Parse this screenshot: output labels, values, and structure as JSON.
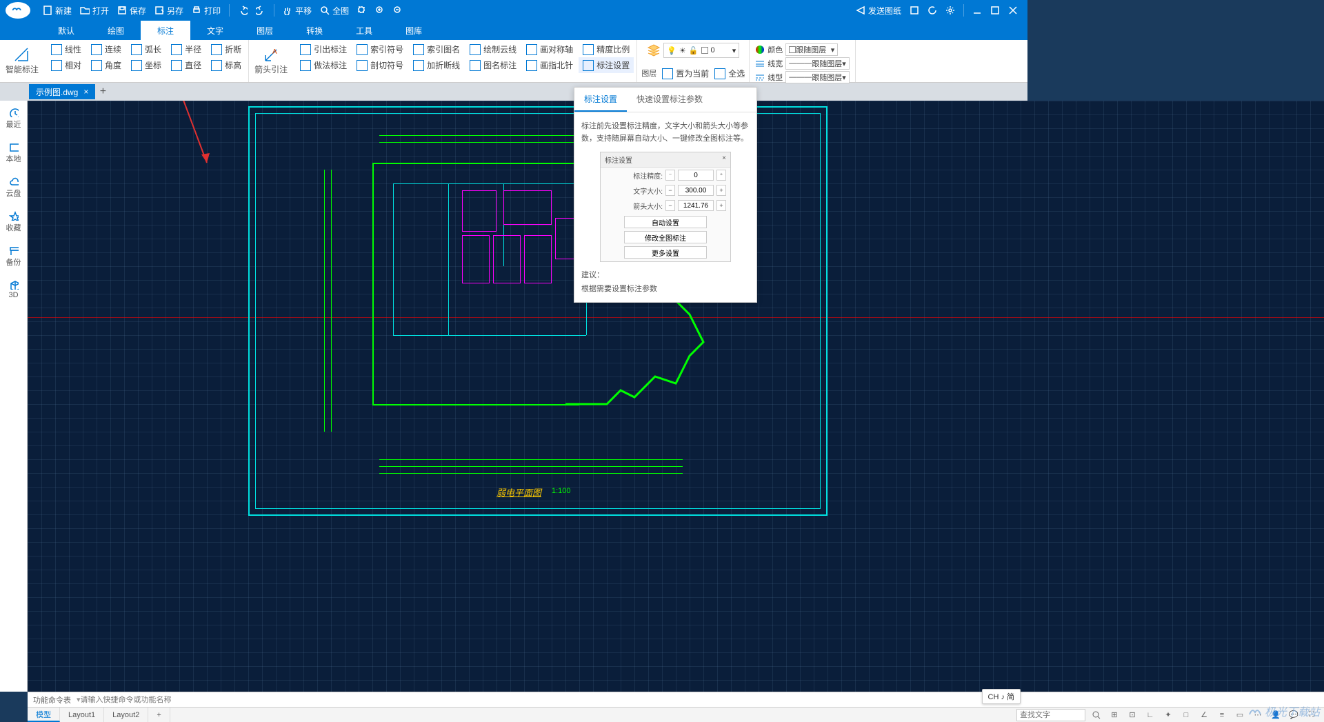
{
  "titlebar": {
    "new": "新建",
    "open": "打开",
    "save": "保存",
    "saveas": "另存",
    "print": "打印",
    "pan": "平移",
    "fullview": "全图",
    "send": "发送图纸"
  },
  "menutabs": {
    "items": [
      "默认",
      "绘图",
      "标注",
      "文字",
      "图层",
      "转换",
      "工具",
      "图库"
    ],
    "active_index": 2
  },
  "ribbon": {
    "smart_dim": "智能标注",
    "r1": {
      "linear": "线性",
      "continuous": "连续",
      "arc": "弧长",
      "radius": "半径",
      "break": "折断"
    },
    "r2": {
      "relative": "相对",
      "angle": "角度",
      "coord": "坐标",
      "diameter": "直径",
      "elevation": "标高"
    },
    "arrow_leader": "箭头引注",
    "r3": {
      "leader": "引出标注",
      "leader_do": "做法标注",
      "index_sym": "索引符号",
      "section_sym": "剖切符号",
      "index_name": "索引图名",
      "break_line": "加折断线",
      "cloud": "绘制云线",
      "image_label": "图名标注",
      "axis": "画对称轴",
      "north": "画指北针",
      "precision": "精度比例",
      "dim_settings": "标注设置"
    },
    "layer_group": "图层",
    "set_current": "置为当前",
    "select_all": "全选",
    "layer_value": "0",
    "prop": {
      "color": "颜色",
      "lineweight": "线宽",
      "linetype": "线型",
      "bylayer": "跟随图层"
    }
  },
  "filetabs": {
    "name": "示例图.dwg"
  },
  "sidebar": {
    "items": [
      {
        "label": "最近",
        "icon": "clock"
      },
      {
        "label": "本地",
        "icon": "monitor"
      },
      {
        "label": "云盘",
        "icon": "cloud"
      },
      {
        "label": "收藏",
        "icon": "star"
      },
      {
        "label": "备份",
        "icon": "archive"
      },
      {
        "label": "3D",
        "icon": "cube"
      }
    ]
  },
  "drawing": {
    "title": "弱电平面图",
    "scale": "1:100"
  },
  "popup": {
    "tab1": "标注设置",
    "tab2": "快速设置标注参数",
    "desc": "标注前先设置标注精度，文字大小和箭头大小等参数，支持随屏幕自动大小、一键修改全图标注等。",
    "mini_title": "标注设置",
    "precision_label": "标注精度:",
    "precision_value": "0",
    "text_size_label": "文字大小:",
    "text_size_value": "300.00",
    "arrow_size_label": "箭头大小:",
    "arrow_size_value": "1241.76",
    "btn_auto": "自动设置",
    "btn_modify": "修改全图标注",
    "btn_more": "更多设置",
    "suggest_title": "建议：",
    "suggest_body": "根据需要设置标注参数"
  },
  "cmdbar": {
    "label": "功能命令表",
    "placeholder": "请输入快捷命令或功能名称"
  },
  "statusbar": {
    "tabs": [
      "模型",
      "Layout1",
      "Layout2"
    ],
    "search_placeholder": "查找文字"
  },
  "ime": "CH ♪ 简",
  "watermark": "极光下载站"
}
